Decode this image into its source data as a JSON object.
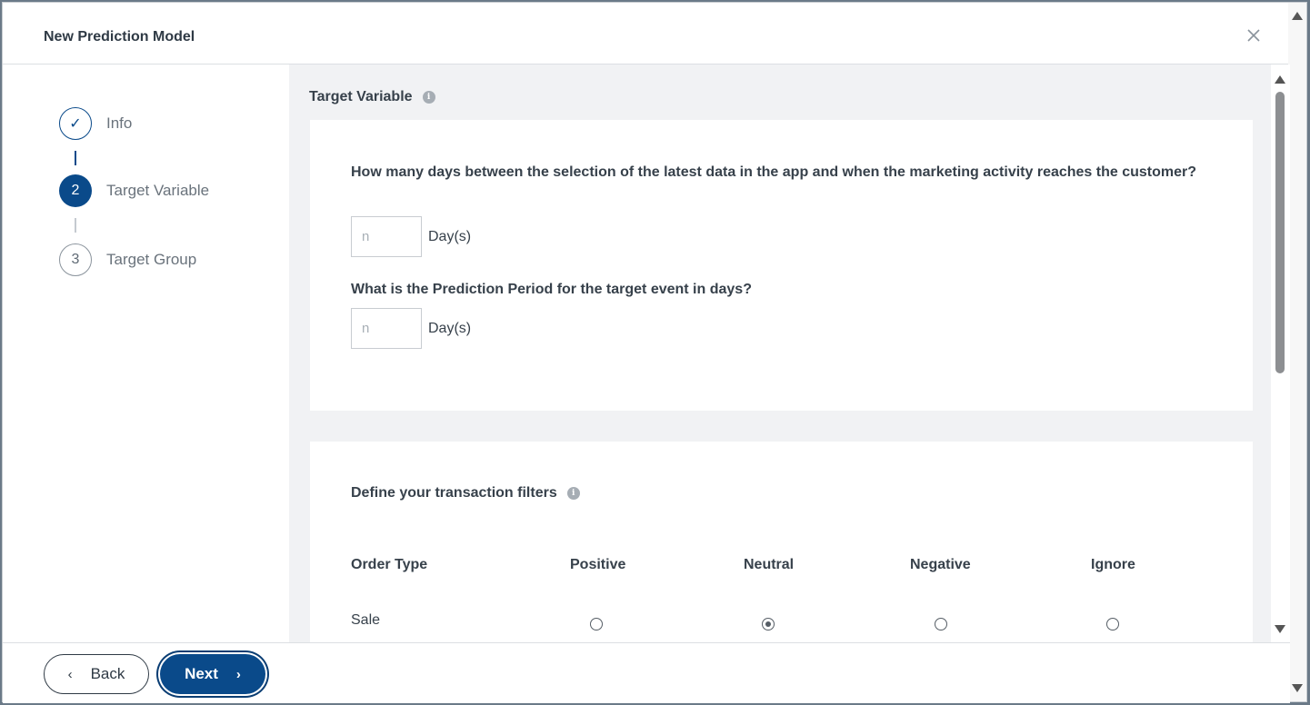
{
  "dialog": {
    "title": "New Prediction Model"
  },
  "steps": [
    {
      "label": "Info",
      "marker": "✓",
      "state": "done"
    },
    {
      "label": "Target Variable",
      "marker": "2",
      "state": "active"
    },
    {
      "label": "Target Group",
      "marker": "3",
      "state": "todo"
    }
  ],
  "main": {
    "section_title": "Target Variable",
    "questions": [
      {
        "text": "How many days between the selection of the latest data in the app and when the marketing activity reaches the customer?",
        "placeholder": "n",
        "value": "",
        "unit": "Day(s)"
      },
      {
        "text": "What is the Prediction Period for the target event in days?",
        "placeholder": "n",
        "value": "",
        "unit": "Day(s)"
      }
    ],
    "filters": {
      "title": "Define your transaction filters",
      "columns": [
        "Order Type",
        "Positive",
        "Neutral",
        "Negative",
        "Ignore"
      ],
      "rows": [
        {
          "label": "Sale",
          "selected": "Neutral"
        }
      ]
    }
  },
  "footer": {
    "back_label": "Back",
    "next_label": "Next"
  },
  "colors": {
    "primary": "#0a4a8a",
    "background": "#f1f2f4",
    "text": "#37414b",
    "muted": "#6a737c"
  }
}
